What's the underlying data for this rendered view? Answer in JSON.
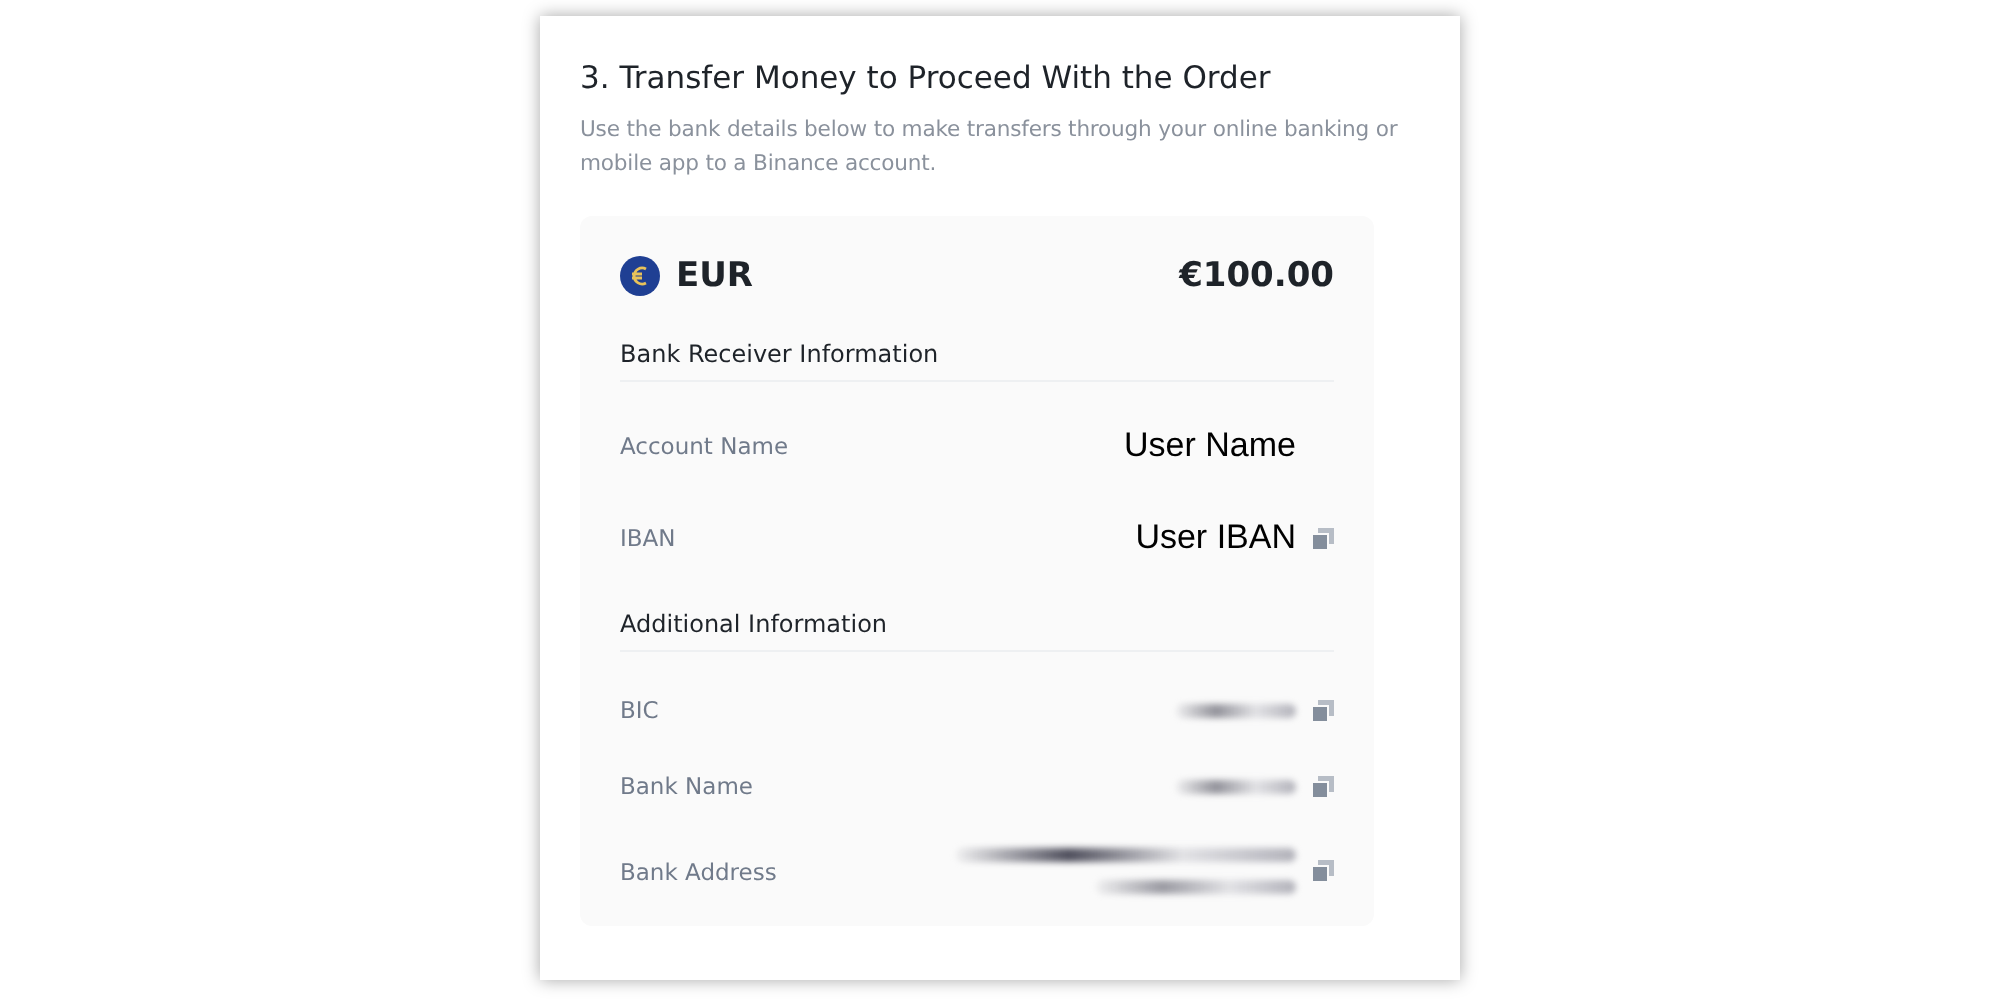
{
  "title": "3. Transfer Money to Proceed With the Order",
  "description": "Use the bank details below to make transfers through your online banking or mobile app to a Binance account.",
  "currency": {
    "code": "EUR",
    "amount": "€100.00"
  },
  "sections": [
    {
      "heading": "Bank Receiver Information",
      "rows": [
        {
          "label": "Account Name",
          "kind": "text",
          "value": "User Name",
          "copyable": false
        },
        {
          "label": "IBAN",
          "kind": "text",
          "value": "User IBAN",
          "copyable": true
        }
      ]
    },
    {
      "heading": "Additional Information",
      "rows": [
        {
          "label": "BIC",
          "kind": "redacted",
          "copyable": true
        },
        {
          "label": "Bank Name",
          "kind": "redacted",
          "copyable": true
        },
        {
          "label": "Bank Address",
          "kind": "redacted-multiline",
          "copyable": true
        }
      ]
    }
  ]
}
